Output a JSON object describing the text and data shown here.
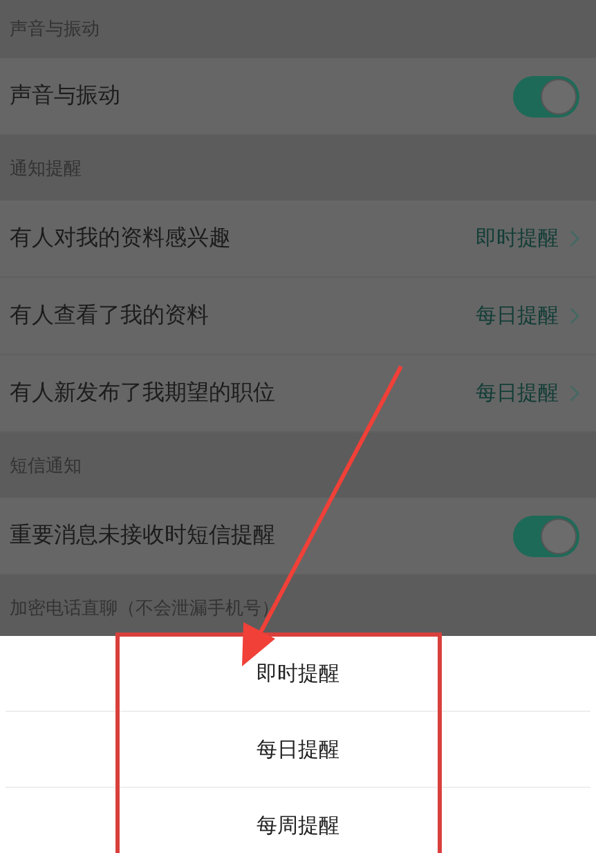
{
  "sections": [
    {
      "header": "声音与振动",
      "rows": [
        {
          "kind": "toggle",
          "label": "声音与振动",
          "on": true
        }
      ]
    },
    {
      "header": "通知提醒",
      "rows": [
        {
          "kind": "option",
          "label": "有人对我的资料感兴趣",
          "value": "即时提醒"
        },
        {
          "kind": "option",
          "label": "有人查看了我的资料",
          "value": "每日提醒"
        },
        {
          "kind": "option",
          "label": "有人新发布了我期望的职位",
          "value": "每日提醒"
        }
      ]
    },
    {
      "header": "短信通知",
      "rows": [
        {
          "kind": "toggle",
          "label": "重要消息未接收时短信提醒",
          "on": true
        }
      ]
    },
    {
      "header": "加密电话直聊（不会泄漏手机号）"
    }
  ],
  "sheet": {
    "options": [
      "即时提醒",
      "每日提醒",
      "每周提醒"
    ]
  }
}
